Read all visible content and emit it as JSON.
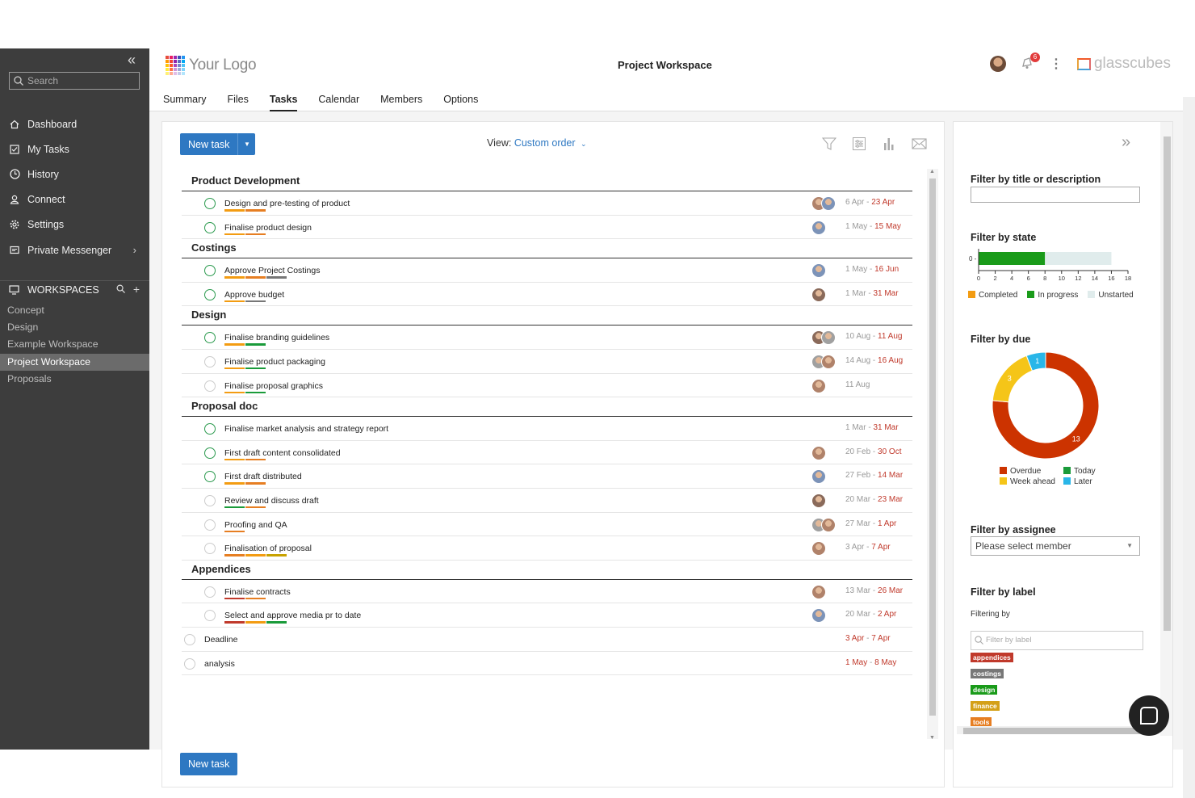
{
  "sidebar": {
    "search_placeholder": "Search",
    "nav": [
      {
        "label": "Dashboard",
        "icon": "home-icon"
      },
      {
        "label": "My Tasks",
        "icon": "checkbox-icon"
      },
      {
        "label": "History",
        "icon": "clock-icon"
      },
      {
        "label": "Connect",
        "icon": "user-icon"
      },
      {
        "label": "Settings",
        "icon": "gear-icon"
      },
      {
        "label": "Private Messenger",
        "icon": "message-icon"
      }
    ],
    "workspaces_label": "WORKSPACES",
    "workspaces": [
      "Concept",
      "Design",
      "Example Workspace",
      "Project Workspace",
      "Proposals"
    ],
    "active_workspace": "Project Workspace"
  },
  "header": {
    "logo_text": "Your Logo",
    "title": "Project Workspace",
    "notification_count": "6",
    "brand": "glasscubes",
    "tabs": [
      "Summary",
      "Files",
      "Tasks",
      "Calendar",
      "Members",
      "Options"
    ],
    "active_tab": "Tasks"
  },
  "toolbar": {
    "new_task_label": "New task",
    "view_label": "View:",
    "view_value": "Custom order"
  },
  "colors": {
    "accent": "#2e78c2",
    "check_green": "#2b9a4e",
    "overdue": "#cc3300",
    "today": "#1a9b3a",
    "week_ahead": "#f5c518",
    "later": "#29b6e8",
    "completed": "#f39c12",
    "in_progress": "#1a9b1a",
    "unstarted": "#e0ecec"
  },
  "task_groups": [
    {
      "title": "Product Development",
      "tasks": [
        {
          "name": "Design and pre-testing of product",
          "date_start": "6 Apr",
          "date_end": "23 Apr",
          "tags": [
            "#f39c12",
            "#e67e22"
          ],
          "avatars": 2,
          "open": true
        },
        {
          "name": "Finalise product design",
          "date_start": "1 May",
          "date_end": "15 May",
          "tags": [
            "#f39c12",
            "#e67e22"
          ],
          "avatars": 1,
          "open": true
        }
      ]
    },
    {
      "title": "Costings",
      "tasks": [
        {
          "name": "Approve Project Costings",
          "date_start": "1 May",
          "date_end": "16 Jun",
          "tags": [
            "#f39c12",
            "#e67e22",
            "#777777"
          ],
          "avatars": 1,
          "open": true
        },
        {
          "name": "Approve budget",
          "date_start": "1 Mar",
          "date_end": "31 Mar",
          "tags": [
            "#f39c12",
            "#777777"
          ],
          "avatars": 1,
          "open": true
        }
      ]
    },
    {
      "title": "Design",
      "tasks": [
        {
          "name": "Finalise branding guidelines",
          "date_start": "10 Aug",
          "date_end": "11 Aug",
          "tags": [
            "#f39c12",
            "#1a9b3a"
          ],
          "avatars": 2,
          "open": true
        },
        {
          "name": "Finalise product packaging",
          "date_start": "14 Aug",
          "date_end": "16 Aug",
          "tags": [
            "#f39c12",
            "#1a9b3a"
          ],
          "avatars": 2,
          "open": false
        },
        {
          "name": "Finalise proposal graphics",
          "date_start": "11 Aug",
          "date_end": "",
          "tags": [
            "#f39c12",
            "#1a9b3a"
          ],
          "avatars": 1,
          "open": false
        }
      ]
    },
    {
      "title": "Proposal doc",
      "tasks": [
        {
          "name": "Finalise market analysis and strategy report",
          "date_start": "1 Mar",
          "date_end": "31 Mar",
          "tags": [],
          "avatars": 0,
          "open": true
        },
        {
          "name": "First draft content consolidated",
          "date_start": "20 Feb",
          "date_end": "30 Oct",
          "tags": [
            "#f39c12",
            "#e67e22"
          ],
          "avatars": 1,
          "open": true
        },
        {
          "name": "First draft distributed",
          "date_start": "27 Feb",
          "date_end": "14 Mar",
          "tags": [
            "#f39c12",
            "#e67e22"
          ],
          "avatars": 1,
          "open": true
        },
        {
          "name": "Review and discuss draft",
          "date_start": "20 Mar",
          "date_end": "23 Mar",
          "tags": [
            "#1a9b3a",
            "#e67e22"
          ],
          "avatars": 1,
          "open": false
        },
        {
          "name": "Proofing and QA",
          "date_start": "27 Mar",
          "date_end": "1 Apr",
          "tags": [
            "#e67e22"
          ],
          "avatars": 2,
          "open": false
        },
        {
          "name": "Finalisation of proposal",
          "date_start": "3 Apr",
          "date_end": "7 Apr",
          "tags": [
            "#e67e22",
            "#f39c12",
            "#c8a200"
          ],
          "avatars": 1,
          "open": false
        }
      ]
    },
    {
      "title": "Appendices",
      "tasks": [
        {
          "name": "Finalise contracts",
          "date_start": "13 Mar",
          "date_end": "26 Mar",
          "tags": [
            "#c0392b",
            "#e67e22"
          ],
          "avatars": 1,
          "open": false
        },
        {
          "name": "Select and approve media pr to date",
          "date_start": "20 Mar",
          "date_end": "2 Apr",
          "tags": [
            "#c0392b",
            "#f39c12",
            "#1a9b3a"
          ],
          "avatars": 1,
          "open": false
        }
      ]
    }
  ],
  "loose_tasks": [
    {
      "name": "Deadline",
      "date_start": "3 Apr",
      "date_end": "7 Apr"
    },
    {
      "name": "analysis",
      "date_start": "1 May",
      "date_end": "8 May"
    }
  ],
  "filters": {
    "title_label": "Filter by title or description",
    "state_label": "Filter by state",
    "due_label": "Filter by due",
    "assignee_label": "Filter by assignee",
    "assignee_placeholder": "Please select member",
    "label_label": "Filter by label",
    "filtering_by": "Filtering by",
    "label_search_placeholder": "Filter by label",
    "labels": [
      {
        "name": "appendices",
        "color": "#c0392b"
      },
      {
        "name": "costings",
        "color": "#777777"
      },
      {
        "name": "design",
        "color": "#1a9b1a"
      },
      {
        "name": "finance",
        "color": "#d4a017"
      },
      {
        "name": "tools",
        "color": "#e67e22"
      }
    ]
  },
  "chart_data": [
    {
      "type": "bar",
      "orientation": "horizontal",
      "categories": [
        "0"
      ],
      "series": [
        {
          "name": "Completed",
          "values": [
            0
          ]
        },
        {
          "name": "In progress",
          "values": [
            8
          ]
        },
        {
          "name": "Unstarted",
          "values": [
            8
          ]
        }
      ],
      "x_ticks": [
        "0",
        "2",
        "4",
        "6",
        "8",
        "10",
        "12",
        "14",
        "16",
        "18"
      ],
      "xlim": [
        0,
        18
      ],
      "legend": "bottom"
    },
    {
      "type": "pie",
      "donut": true,
      "categories": [
        "Overdue",
        "Today",
        "Week ahead",
        "Later"
      ],
      "values": [
        13,
        0,
        3,
        1
      ],
      "legend": "bottom"
    }
  ]
}
